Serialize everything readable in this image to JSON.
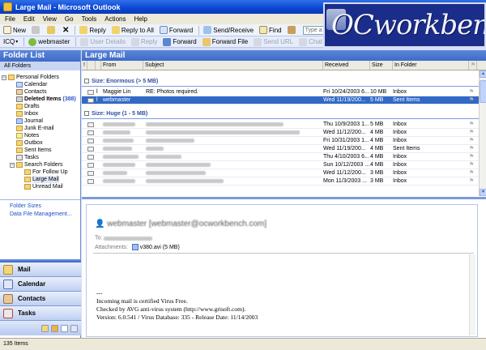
{
  "window": {
    "title": "Large Mail - Microsoft Outlook"
  },
  "menu": [
    "File",
    "Edit",
    "View",
    "Go",
    "Tools",
    "Actions",
    "Help"
  ],
  "toolbar1": {
    "new": "New",
    "reply": "Reply",
    "reply_all": "Reply to All",
    "forward": "Forward",
    "send_receive": "Send/Receive",
    "find": "Find",
    "search_placeholder": "Type a contact to find"
  },
  "toolbar2": {
    "icq": "ICQ",
    "webmaster": "webmaster",
    "user_details": "User Details",
    "reply": "Reply",
    "forward": "Forward",
    "forward_file": "Forward File",
    "send_url": "Send URL",
    "chat_request": "Chat Request"
  },
  "banner": {
    "text": "OCworkbench"
  },
  "folder_pane": {
    "title": "Folder List",
    "all_folders": "All Folders",
    "folders": [
      {
        "label": "Personal Folders",
        "count": "",
        "bold": false
      },
      {
        "label": "Calendar",
        "count": "",
        "bold": false
      },
      {
        "label": "Contacts",
        "count": "",
        "bold": false
      },
      {
        "label": "Deleted Items",
        "count": "(388)",
        "bold": true
      },
      {
        "label": "Drafts",
        "count": "",
        "bold": false
      },
      {
        "label": "Inbox",
        "count": "",
        "bold": false
      },
      {
        "label": "Journal",
        "count": "",
        "bold": false
      },
      {
        "label": "Junk E-mail",
        "count": "",
        "bold": false
      },
      {
        "label": "Notes",
        "count": "",
        "bold": false
      },
      {
        "label": "Outbox",
        "count": "",
        "bold": false
      },
      {
        "label": "Sent Items",
        "count": "",
        "bold": false
      },
      {
        "label": "Tasks",
        "count": "",
        "bold": false
      },
      {
        "label": "Search Folders",
        "count": "",
        "bold": false
      },
      {
        "label": "For Follow Up",
        "count": "",
        "bold": false
      },
      {
        "label": "Large Mail",
        "count": "",
        "bold": false
      },
      {
        "label": "Unread Mail",
        "count": "",
        "bold": false
      }
    ],
    "links": [
      "Folder Sizes",
      "Data File Management..."
    ]
  },
  "nav_buttons": [
    "Mail",
    "Calendar",
    "Contacts",
    "Tasks"
  ],
  "main": {
    "title": "Large Mail",
    "columns": [
      "!",
      "",
      "",
      "From",
      "Subject",
      "Received",
      "Size",
      "In Folder",
      ""
    ],
    "groups": [
      {
        "label": "Size: Enormous  (> 5 MB)",
        "rows": [
          {
            "from": "Maggie Lin",
            "subject": "RE: Photos required.",
            "received": "Fri 10/24/2003 6...",
            "size": "10 MB",
            "folder": "Inbox",
            "selected": false
          },
          {
            "from": "webmaster",
            "subject": "",
            "received": "Wed 11/19/200...",
            "size": "5 MB",
            "folder": "Sent Items",
            "selected": true
          }
        ]
      },
      {
        "label": "Size: Huge  (1 - 5 MB)",
        "rows": [
          {
            "from": "",
            "subject": "",
            "received": "Thu 10/9/2003 1...",
            "size": "5 MB",
            "folder": "Inbox",
            "selected": false
          },
          {
            "from": "",
            "subject": "",
            "received": "Wed 11/12/200...",
            "size": "4 MB",
            "folder": "Inbox",
            "selected": false
          },
          {
            "from": "",
            "subject": "",
            "received": "Fri 10/31/2003 1...",
            "size": "4 MB",
            "folder": "Inbox",
            "selected": false
          },
          {
            "from": "",
            "subject": "",
            "received": "Wed 11/19/200...",
            "size": "4 MB",
            "folder": "Sent Items",
            "selected": false
          },
          {
            "from": "",
            "subject": "",
            "received": "Thu 4/10/2003 6...",
            "size": "4 MB",
            "folder": "Inbox",
            "selected": false
          },
          {
            "from": "",
            "subject": "",
            "received": "Sun 10/12/2003 ...",
            "size": "4 MB",
            "folder": "Inbox",
            "selected": false
          },
          {
            "from": "",
            "subject": "",
            "received": "Wed 11/12/200...",
            "size": "3 MB",
            "folder": "Inbox",
            "selected": false
          },
          {
            "from": "",
            "subject": "",
            "received": "Mon 11/3/2003 ...",
            "size": "3 MB",
            "folder": "Inbox",
            "selected": false
          }
        ]
      }
    ]
  },
  "reading_pane": {
    "from": "webmaster [webmaster@ocworkbench.com]",
    "to_label": "To:",
    "attachments_label": "Attachments:",
    "attachment": "v380.avi (5 MB)",
    "body": [
      "---",
      "Incoming mail is certified Virus Free.",
      "Checked by AVG anti-virus system (http://www.grisoft.com).",
      "Version: 6.0.541 / Virus Database: 335 - Release Date: 11/14/2003"
    ]
  },
  "status": {
    "text": "135 Items"
  },
  "colors": {
    "accent": "#3e6bc7",
    "selection": "#316ac5",
    "group_text": "#2f4fa3",
    "banner_bg": "#1b2d8a"
  }
}
